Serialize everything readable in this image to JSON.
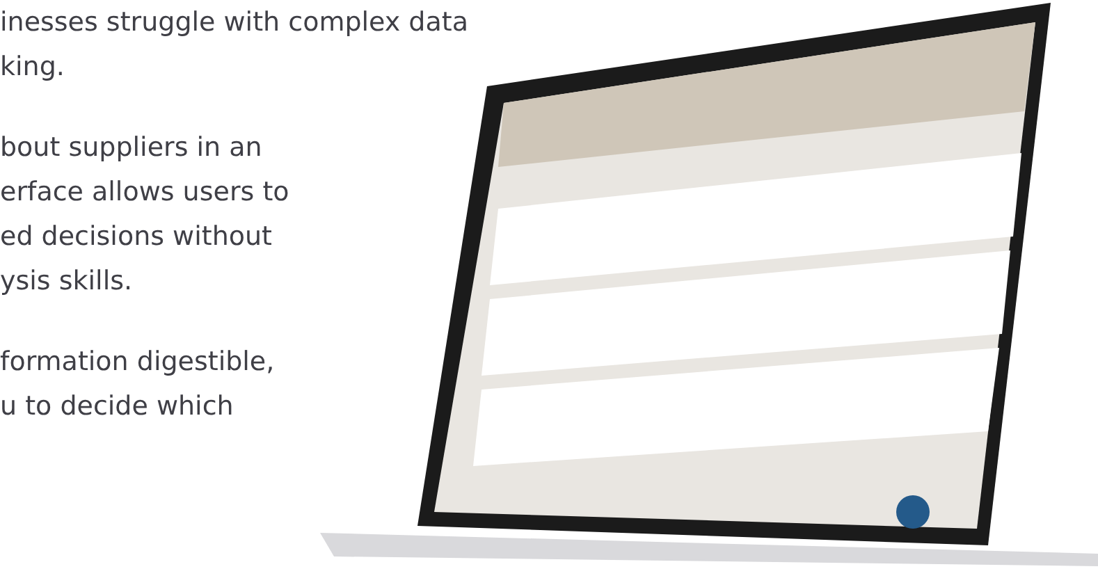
{
  "paragraphs": [
    {
      "lines": [
        "inesses struggle with complex data",
        "king."
      ]
    },
    {
      "lines": [
        "bout suppliers in an",
        "erface allows users to",
        "ed decisions without",
        "ysis skills."
      ]
    },
    {
      "lines": [
        "formation digestible,",
        "u to decide which"
      ]
    }
  ]
}
